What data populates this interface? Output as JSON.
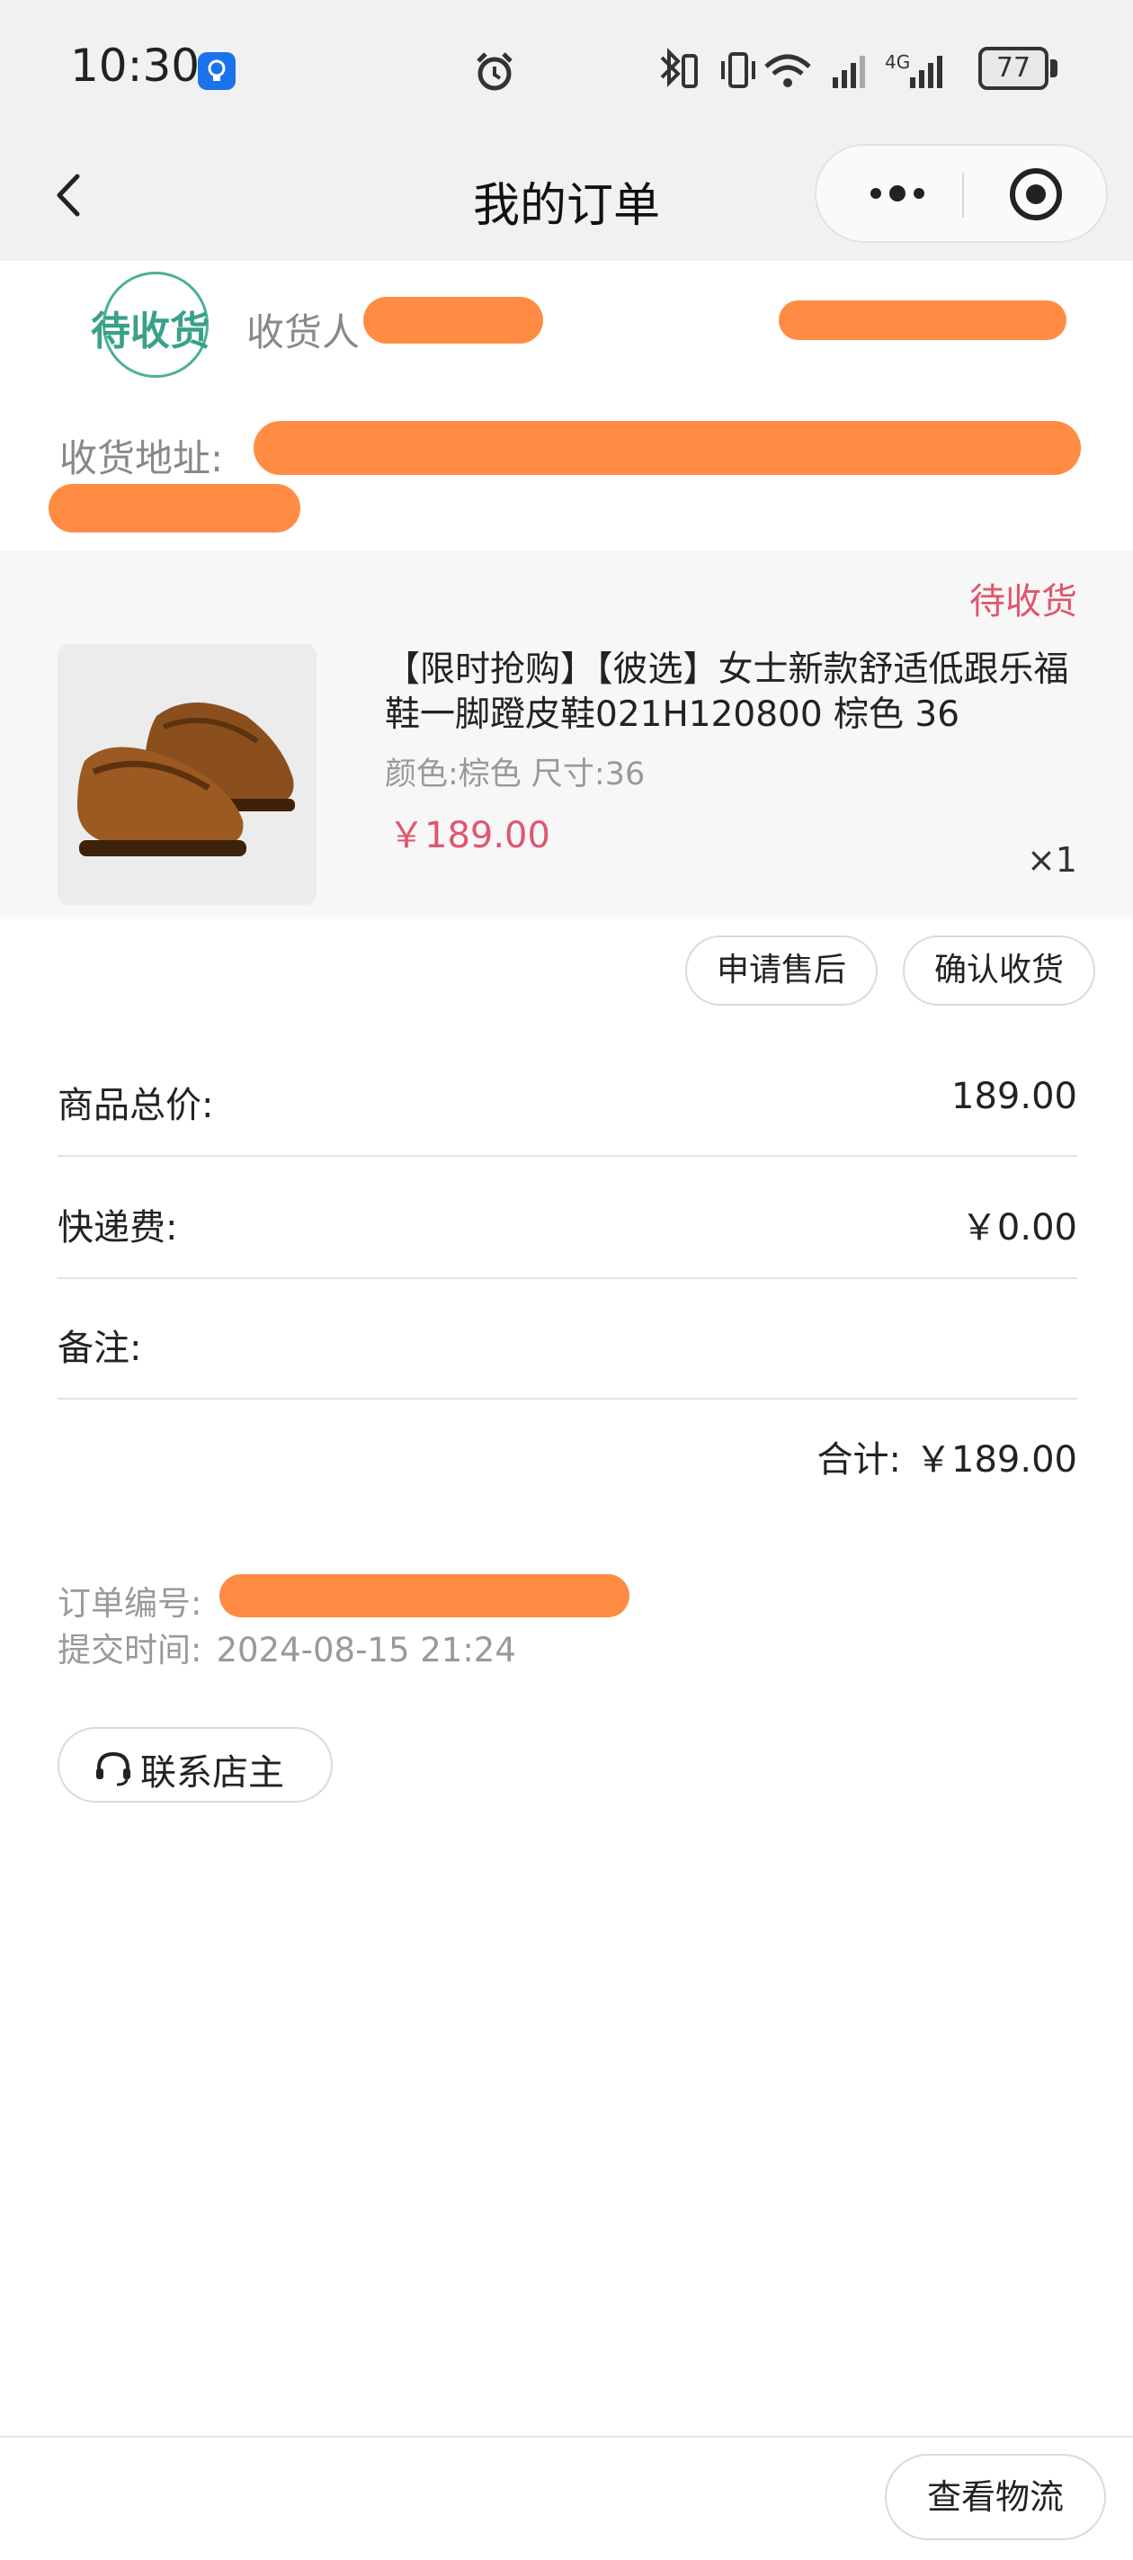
{
  "status_bar": {
    "time": "10:30",
    "battery": "77",
    "network": "4G"
  },
  "nav": {
    "title": "我的订单"
  },
  "address": {
    "stamp": "待收货",
    "recipient_label": "收货人",
    "address_label": "收货地址:"
  },
  "order": {
    "status": "待收货",
    "product": {
      "name": "【限时抢购】【彼选】女士新款舒适低跟乐福鞋一脚蹬皮鞋021H120800 棕色 36",
      "spec": "颜色:棕色 尺寸:36",
      "price": "￥189.00",
      "quantity": "×1"
    }
  },
  "actions": {
    "after_sales": "申请售后",
    "confirm_receipt": "确认收货"
  },
  "summary": {
    "goods_total_label": "商品总价:",
    "goods_total_value": "189.00",
    "shipping_label": "快递费:",
    "shipping_value": "￥0.00",
    "remark_label": "备注:",
    "remark_value": "",
    "total_label": "合计:",
    "total_value": "￥189.00"
  },
  "meta": {
    "order_no_label": "订单编号:",
    "submit_time_label": "提交时间:",
    "submit_time_value": "2024-08-15 21:24"
  },
  "contact": {
    "label": "联系店主"
  },
  "bottom": {
    "logistics": "查看物流"
  },
  "colors": {
    "accent_pink": "#e0566e",
    "stamp_green": "#3aa189",
    "redaction": "#ff8c42"
  }
}
